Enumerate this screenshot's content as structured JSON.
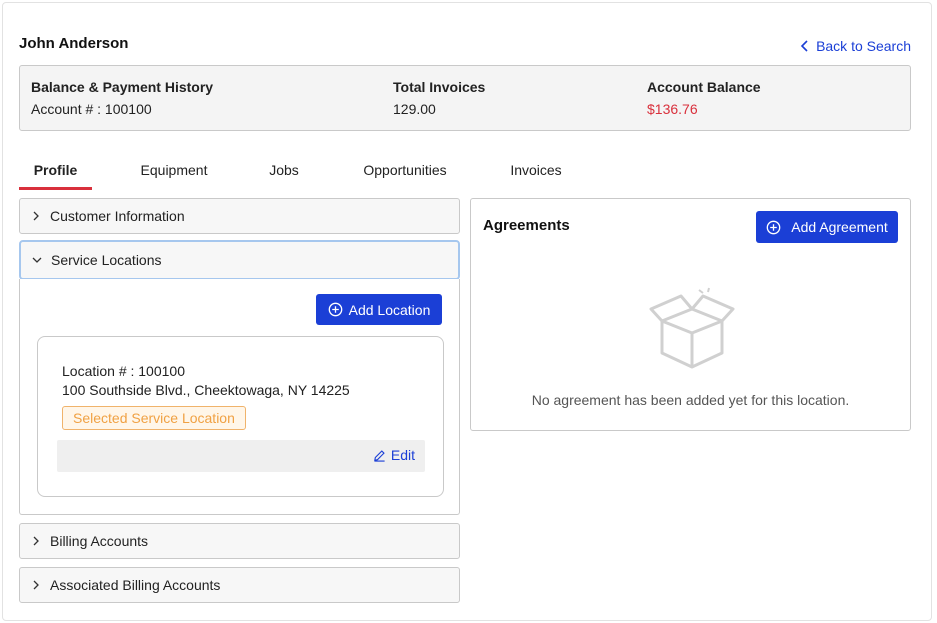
{
  "header": {
    "customer_name": "John Anderson",
    "back_link": "Back to Search"
  },
  "summary": {
    "balance_heading": "Balance & Payment History",
    "account_number": "Account # : 100100",
    "invoices_heading": "Total Invoices",
    "invoices_value": "129.00",
    "account_balance_heading": "Account Balance",
    "account_balance_value": "$136.76",
    "negative_color": "#d9303c"
  },
  "tabs": [
    {
      "label": "Profile",
      "active": true
    },
    {
      "label": "Equipment",
      "active": false
    },
    {
      "label": "Jobs",
      "active": false
    },
    {
      "label": "Opportunities",
      "active": false
    },
    {
      "label": "Invoices",
      "active": false
    }
  ],
  "profile": {
    "customer_information": "Customer Information",
    "service_locations": "Service Locations",
    "add_location": "Add Location",
    "location": {
      "number": "Location # : 100100",
      "address": "100 Southside Blvd., Cheektowaga, NY 14225",
      "badge": "Selected Service Location",
      "edit": "Edit"
    },
    "billing_accounts": "Billing Accounts",
    "associated_billing_accounts": "Associated Billing Accounts"
  },
  "agreements": {
    "title": "Agreements",
    "add_button": "Add Agreement",
    "empty_icon": "empty-box-icon",
    "empty_message": "No agreement has been added yet for this location."
  },
  "colors": {
    "primary": "#1b3fd6",
    "accent_red": "#d9303c",
    "badge_orange": "#f0a143"
  }
}
